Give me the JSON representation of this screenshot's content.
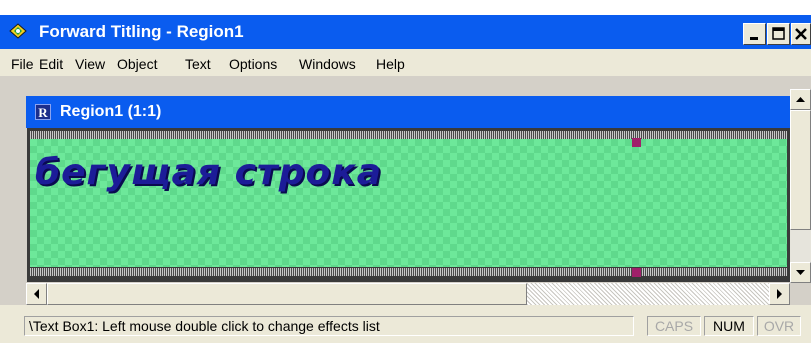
{
  "window": {
    "title": "Forward Titling - Region1",
    "controls": {
      "minimize": "minimize-icon",
      "maximize": "maximize-icon",
      "close": "close-icon"
    }
  },
  "menu": {
    "items": [
      "File",
      "Edit",
      "View",
      "Object",
      "Text",
      "Options",
      "Windows",
      "Help"
    ]
  },
  "child": {
    "icon_letter": "R",
    "title": "Region1  (1:1)"
  },
  "canvas": {
    "text": "бегущая строка",
    "colors": {
      "background": "#6de89a",
      "text": "#1c1c98",
      "handle": "#a0206a"
    }
  },
  "status": {
    "message": "\\Text Box1: Left mouse double click to change effects list",
    "caps": "CAPS",
    "num": "NUM",
    "ovr": "OVR"
  },
  "colors": {
    "titlebar": "#0a5cef",
    "chrome": "#ece9d8"
  }
}
